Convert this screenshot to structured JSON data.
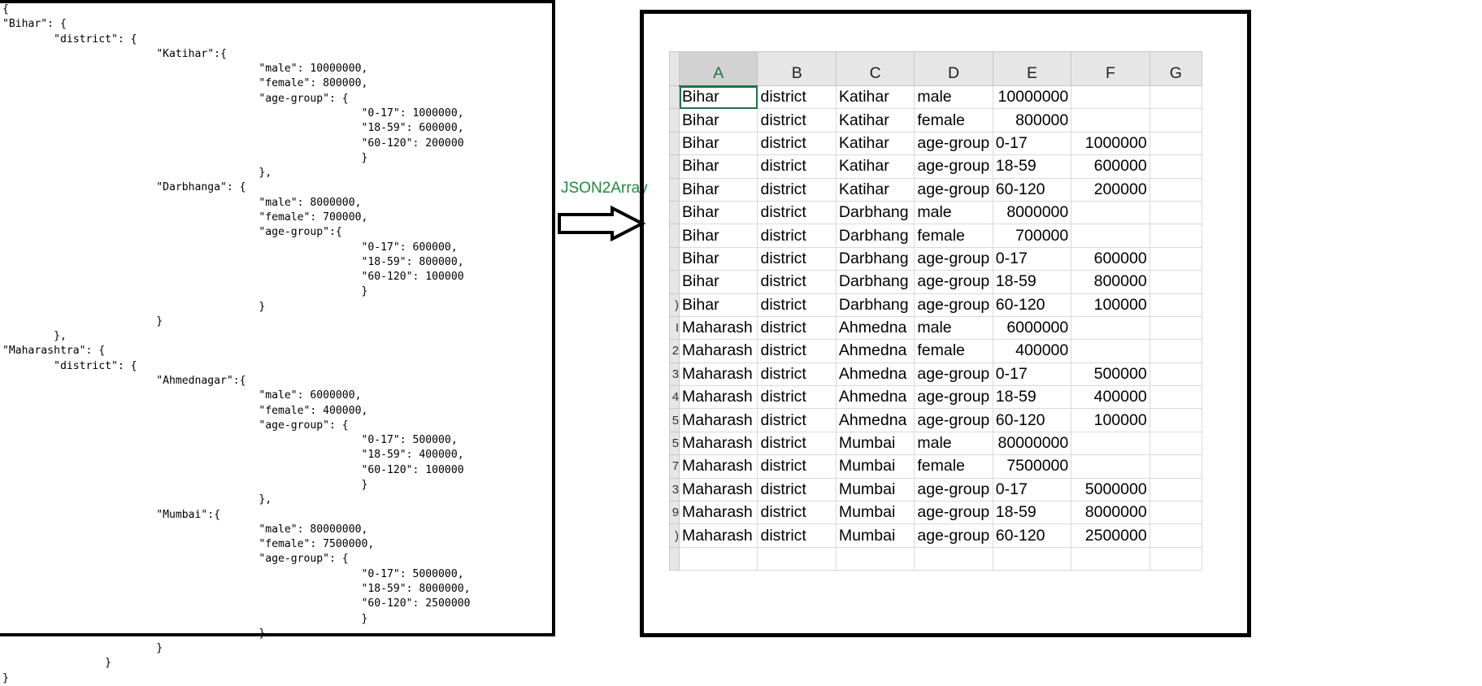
{
  "json_panel": {
    "lines": [
      "{",
      "\"Bihar\": {",
      "        \"district\": {",
      "                        \"Katihar\":{",
      "                                        \"male\": 10000000,",
      "                                        \"female\": 800000,",
      "                                        \"age-group\": {",
      "                                                        \"0-17\": 1000000,",
      "                                                        \"18-59\": 600000,",
      "                                                        \"60-120\": 200000",
      "                                                        }",
      "                                        },",
      "                        \"Darbhanga\": {",
      "                                        \"male\": 8000000,",
      "                                        \"female\": 700000,",
      "                                        \"age-group\":{",
      "                                                        \"0-17\": 600000,",
      "                                                        \"18-59\": 800000,",
      "                                                        \"60-120\": 100000",
      "                                                        }",
      "                                        }",
      "                        }",
      "        },",
      "\"Maharashtra\": {",
      "        \"district\": {",
      "                        \"Ahmednagar\":{",
      "                                        \"male\": 6000000,",
      "                                        \"female\": 400000,",
      "                                        \"age-group\": {",
      "                                                        \"0-17\": 500000,",
      "                                                        \"18-59\": 400000,",
      "                                                        \"60-120\": 100000",
      "                                                        }",
      "                                        },",
      "                        \"Mumbai\":{",
      "                                        \"male\": 80000000,",
      "                                        \"female\": 7500000,",
      "                                        \"age-group\": {",
      "                                                        \"0-17\": 5000000,",
      "                                                        \"18-59\": 8000000,",
      "                                                        \"60-120\": 2500000",
      "                                                        }",
      "                                        }",
      "                        }",
      "                }",
      "}"
    ]
  },
  "arrow": {
    "label": "JSON2Array",
    "label_color": "#1f8a3c"
  },
  "sheet": {
    "columns": [
      "A",
      "B",
      "C",
      "D",
      "E",
      "F",
      "G"
    ],
    "selected_column": "A",
    "row_numbers": [
      "",
      "",
      "",
      "",
      "",
      "",
      "",
      "",
      "",
      ")",
      "I",
      "2",
      "3",
      "4",
      "5",
      "5",
      "7",
      "3",
      "9",
      ")"
    ],
    "rows": [
      [
        "Bihar",
        "district",
        "Katihar",
        "male",
        "10000000",
        "",
        ""
      ],
      [
        "Bihar",
        "district",
        "Katihar",
        "female",
        "800000",
        "",
        ""
      ],
      [
        "Bihar",
        "district",
        "Katihar",
        "age-group",
        "0-17",
        "1000000",
        ""
      ],
      [
        "Bihar",
        "district",
        "Katihar",
        "age-group",
        "18-59",
        "600000",
        ""
      ],
      [
        "Bihar",
        "district",
        "Katihar",
        "age-group",
        "60-120",
        "200000",
        ""
      ],
      [
        "Bihar",
        "district",
        "Darbhang",
        "male",
        "8000000",
        "",
        ""
      ],
      [
        "Bihar",
        "district",
        "Darbhang",
        "female",
        "700000",
        "",
        ""
      ],
      [
        "Bihar",
        "district",
        "Darbhang",
        "age-group",
        "0-17",
        "600000",
        ""
      ],
      [
        "Bihar",
        "district",
        "Darbhang",
        "age-group",
        "18-59",
        "800000",
        ""
      ],
      [
        "Bihar",
        "district",
        "Darbhang",
        "age-group",
        "60-120",
        "100000",
        ""
      ],
      [
        "Maharash",
        "district",
        "Ahmedna",
        "male",
        "6000000",
        "",
        ""
      ],
      [
        "Maharash",
        "district",
        "Ahmedna",
        "female",
        "400000",
        "",
        ""
      ],
      [
        "Maharash",
        "district",
        "Ahmedna",
        "age-group",
        "0-17",
        "500000",
        ""
      ],
      [
        "Maharash",
        "district",
        "Ahmedna",
        "age-group",
        "18-59",
        "400000",
        ""
      ],
      [
        "Maharash",
        "district",
        "Ahmedna",
        "age-group",
        "60-120",
        "100000",
        ""
      ],
      [
        "Maharash",
        "district",
        "Mumbai",
        "male",
        "80000000",
        "",
        ""
      ],
      [
        "Maharash",
        "district",
        "Mumbai",
        "female",
        "7500000",
        "",
        ""
      ],
      [
        "Maharash",
        "district",
        "Mumbai",
        "age-group",
        "0-17",
        "5000000",
        ""
      ],
      [
        "Maharash",
        "district",
        "Mumbai",
        "age-group",
        "18-59",
        "8000000",
        ""
      ],
      [
        "Maharash",
        "district",
        "Mumbai",
        "age-group",
        "60-120",
        "2500000",
        ""
      ]
    ],
    "accent_color": "#217346"
  }
}
